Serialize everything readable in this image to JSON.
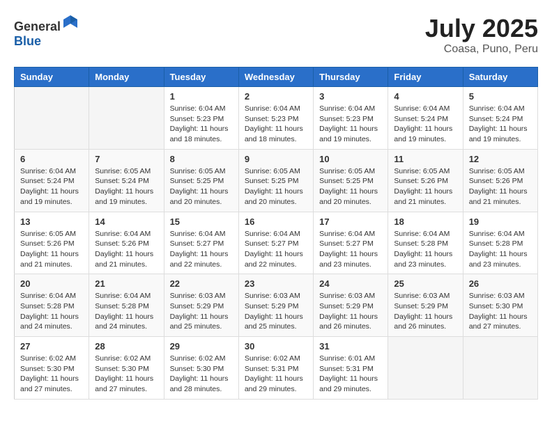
{
  "header": {
    "logo_general": "General",
    "logo_blue": "Blue",
    "month_year": "July 2025",
    "location": "Coasa, Puno, Peru"
  },
  "days_of_week": [
    "Sunday",
    "Monday",
    "Tuesday",
    "Wednesday",
    "Thursday",
    "Friday",
    "Saturday"
  ],
  "weeks": [
    [
      {
        "day": "",
        "info": ""
      },
      {
        "day": "",
        "info": ""
      },
      {
        "day": "1",
        "info": "Sunrise: 6:04 AM\nSunset: 5:23 PM\nDaylight: 11 hours and 18 minutes."
      },
      {
        "day": "2",
        "info": "Sunrise: 6:04 AM\nSunset: 5:23 PM\nDaylight: 11 hours and 18 minutes."
      },
      {
        "day": "3",
        "info": "Sunrise: 6:04 AM\nSunset: 5:23 PM\nDaylight: 11 hours and 19 minutes."
      },
      {
        "day": "4",
        "info": "Sunrise: 6:04 AM\nSunset: 5:24 PM\nDaylight: 11 hours and 19 minutes."
      },
      {
        "day": "5",
        "info": "Sunrise: 6:04 AM\nSunset: 5:24 PM\nDaylight: 11 hours and 19 minutes."
      }
    ],
    [
      {
        "day": "6",
        "info": "Sunrise: 6:04 AM\nSunset: 5:24 PM\nDaylight: 11 hours and 19 minutes."
      },
      {
        "day": "7",
        "info": "Sunrise: 6:05 AM\nSunset: 5:24 PM\nDaylight: 11 hours and 19 minutes."
      },
      {
        "day": "8",
        "info": "Sunrise: 6:05 AM\nSunset: 5:25 PM\nDaylight: 11 hours and 20 minutes."
      },
      {
        "day": "9",
        "info": "Sunrise: 6:05 AM\nSunset: 5:25 PM\nDaylight: 11 hours and 20 minutes."
      },
      {
        "day": "10",
        "info": "Sunrise: 6:05 AM\nSunset: 5:25 PM\nDaylight: 11 hours and 20 minutes."
      },
      {
        "day": "11",
        "info": "Sunrise: 6:05 AM\nSunset: 5:26 PM\nDaylight: 11 hours and 21 minutes."
      },
      {
        "day": "12",
        "info": "Sunrise: 6:05 AM\nSunset: 5:26 PM\nDaylight: 11 hours and 21 minutes."
      }
    ],
    [
      {
        "day": "13",
        "info": "Sunrise: 6:05 AM\nSunset: 5:26 PM\nDaylight: 11 hours and 21 minutes."
      },
      {
        "day": "14",
        "info": "Sunrise: 6:04 AM\nSunset: 5:26 PM\nDaylight: 11 hours and 21 minutes."
      },
      {
        "day": "15",
        "info": "Sunrise: 6:04 AM\nSunset: 5:27 PM\nDaylight: 11 hours and 22 minutes."
      },
      {
        "day": "16",
        "info": "Sunrise: 6:04 AM\nSunset: 5:27 PM\nDaylight: 11 hours and 22 minutes."
      },
      {
        "day": "17",
        "info": "Sunrise: 6:04 AM\nSunset: 5:27 PM\nDaylight: 11 hours and 23 minutes."
      },
      {
        "day": "18",
        "info": "Sunrise: 6:04 AM\nSunset: 5:28 PM\nDaylight: 11 hours and 23 minutes."
      },
      {
        "day": "19",
        "info": "Sunrise: 6:04 AM\nSunset: 5:28 PM\nDaylight: 11 hours and 23 minutes."
      }
    ],
    [
      {
        "day": "20",
        "info": "Sunrise: 6:04 AM\nSunset: 5:28 PM\nDaylight: 11 hours and 24 minutes."
      },
      {
        "day": "21",
        "info": "Sunrise: 6:04 AM\nSunset: 5:28 PM\nDaylight: 11 hours and 24 minutes."
      },
      {
        "day": "22",
        "info": "Sunrise: 6:03 AM\nSunset: 5:29 PM\nDaylight: 11 hours and 25 minutes."
      },
      {
        "day": "23",
        "info": "Sunrise: 6:03 AM\nSunset: 5:29 PM\nDaylight: 11 hours and 25 minutes."
      },
      {
        "day": "24",
        "info": "Sunrise: 6:03 AM\nSunset: 5:29 PM\nDaylight: 11 hours and 26 minutes."
      },
      {
        "day": "25",
        "info": "Sunrise: 6:03 AM\nSunset: 5:29 PM\nDaylight: 11 hours and 26 minutes."
      },
      {
        "day": "26",
        "info": "Sunrise: 6:03 AM\nSunset: 5:30 PM\nDaylight: 11 hours and 27 minutes."
      }
    ],
    [
      {
        "day": "27",
        "info": "Sunrise: 6:02 AM\nSunset: 5:30 PM\nDaylight: 11 hours and 27 minutes."
      },
      {
        "day": "28",
        "info": "Sunrise: 6:02 AM\nSunset: 5:30 PM\nDaylight: 11 hours and 27 minutes."
      },
      {
        "day": "29",
        "info": "Sunrise: 6:02 AM\nSunset: 5:30 PM\nDaylight: 11 hours and 28 minutes."
      },
      {
        "day": "30",
        "info": "Sunrise: 6:02 AM\nSunset: 5:31 PM\nDaylight: 11 hours and 29 minutes."
      },
      {
        "day": "31",
        "info": "Sunrise: 6:01 AM\nSunset: 5:31 PM\nDaylight: 11 hours and 29 minutes."
      },
      {
        "day": "",
        "info": ""
      },
      {
        "day": "",
        "info": ""
      }
    ]
  ]
}
